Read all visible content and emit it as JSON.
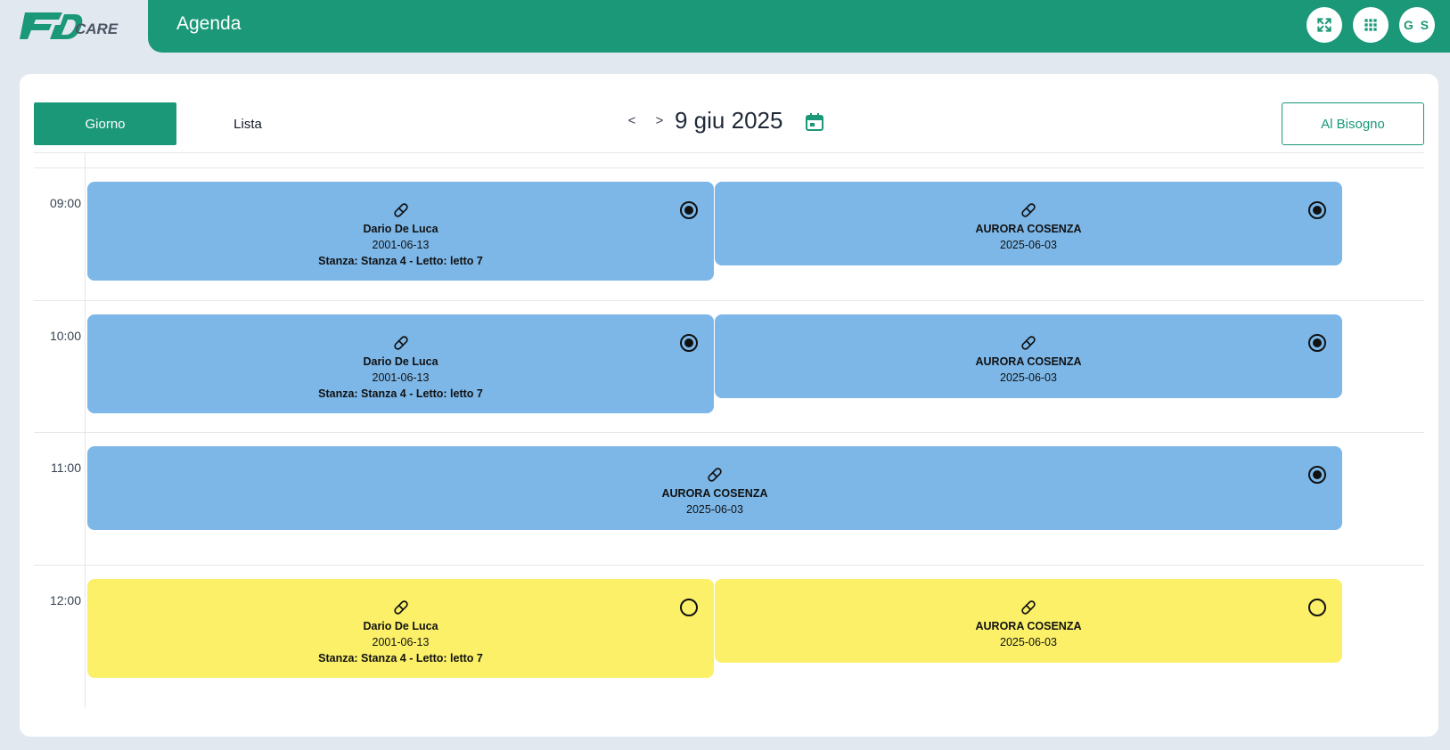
{
  "header": {
    "title": "Agenda",
    "logo_text": "Fid CARE",
    "fullscreen_icon": "fullscreen-icon",
    "apps_icon": "apps-grid-icon",
    "user_initials": "G S"
  },
  "colors": {
    "brand": "#1a9878",
    "event_done": "#7cb7e8",
    "event_pending": "#fbf068"
  },
  "toolbar": {
    "tab_day": "Giorno",
    "tab_list": "Lista",
    "prev": "<",
    "next": ">",
    "date": "9 giu 2025",
    "calendar_icon": "calendar-icon",
    "as_needed_button": "Al Bisogno"
  },
  "schedule": {
    "slots": [
      {
        "time": "09:00",
        "events": [
          {
            "icon": "pill-icon",
            "name": "Dario De Luca",
            "date": "2001-06-13",
            "room": "Stanza: Stanza 4 - Letto: letto 7",
            "status": "done"
          },
          {
            "icon": "pill-icon",
            "name": "AURORA COSENZA",
            "date": "2025-06-03",
            "status": "done"
          }
        ]
      },
      {
        "time": "10:00",
        "events": [
          {
            "icon": "pill-icon",
            "name": "Dario De Luca",
            "date": "2001-06-13",
            "room": "Stanza: Stanza 4 - Letto: letto 7",
            "status": "done"
          },
          {
            "icon": "pill-icon",
            "name": "AURORA COSENZA",
            "date": "2025-06-03",
            "status": "done"
          }
        ]
      },
      {
        "time": "11:00",
        "events": [
          {
            "icon": "pill-icon",
            "name": "AURORA COSENZA",
            "date": "2025-06-03",
            "status": "done"
          }
        ]
      },
      {
        "time": "12:00",
        "events": [
          {
            "icon": "pill-icon",
            "name": "Dario De Luca",
            "date": "2001-06-13",
            "room": "Stanza: Stanza 4 - Letto: letto 7",
            "status": "pending"
          },
          {
            "icon": "pill-icon",
            "name": "AURORA COSENZA",
            "date": "2025-06-03",
            "status": "pending"
          }
        ]
      }
    ]
  }
}
